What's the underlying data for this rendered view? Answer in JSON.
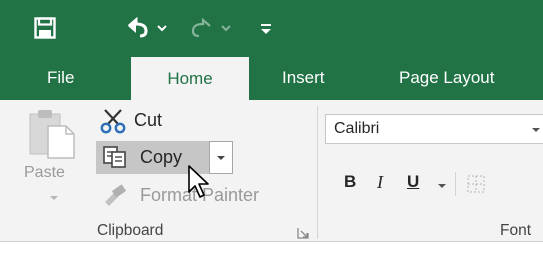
{
  "colors": {
    "accent": "#217346",
    "ribbon_bg": "#f3f3f3",
    "disabled": "#9a9a9a",
    "selected_btn": "#c6c6c6"
  },
  "quick_access": [
    {
      "name": "save",
      "icon": "save-icon"
    },
    {
      "name": "undo",
      "icon": "undo-icon"
    },
    {
      "name": "undo-dropdown",
      "icon": "chevron-down-icon"
    },
    {
      "name": "redo",
      "icon": "redo-icon"
    },
    {
      "name": "redo-dropdown",
      "icon": "chevron-down-icon"
    },
    {
      "name": "customize",
      "icon": "customize-qat-icon"
    }
  ],
  "tabs": [
    {
      "label": "File",
      "active": false
    },
    {
      "label": "Home",
      "active": true
    },
    {
      "label": "Insert",
      "active": false
    },
    {
      "label": "Page Layout",
      "active": false
    }
  ],
  "clipboard": {
    "paste_label": "Paste",
    "cut_label": "Cut",
    "copy_label": "Copy",
    "format_painter_label": "Format Painter",
    "group_label": "Clipboard"
  },
  "font": {
    "font_name": "Calibri",
    "bold": "B",
    "italic": "I",
    "underline": "U",
    "group_label": "Font"
  }
}
